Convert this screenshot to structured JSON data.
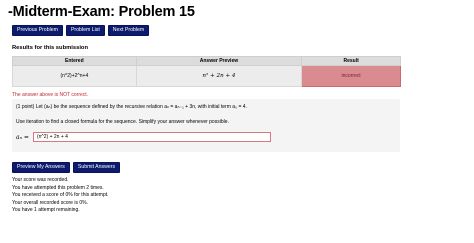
{
  "page": {
    "title": "-Midterm-Exam: Problem 15"
  },
  "nav": {
    "previous_label": "Previous Problem",
    "list_label": "Problem List",
    "next_label": "Next Problem"
  },
  "results": {
    "heading": "Results for this submission",
    "columns": [
      "Entered",
      "Answer Preview",
      "Result"
    ],
    "row": {
      "entered": "(n^2)+2^n+4",
      "preview": "n² + 2n + 4",
      "result": "incorrect"
    }
  },
  "feedback": {
    "warning": "The answer above is NOT correct."
  },
  "problem": {
    "intro": "(1 point) Let (aₙ) be the sequence defined by the recursive relation aₙ = aₙ₋₁ + 3n, with initial term a₀ = 4.",
    "instruction": "Use iteration to find a closed formula for the sequence. Simplify your answer whenever possible.",
    "answer_label": "aₙ =",
    "answer_value": "(n^2) + 2n + 4"
  },
  "actions": {
    "preview_label": "Preview My Answers",
    "submit_label": "Submit Answers"
  },
  "status": {
    "lines": [
      "Your score was recorded.",
      "You have attempted this problem 2 times.",
      "You received a score of 0% for this attempt.",
      "Your overall recorded score is 0%.",
      "You have 1 attempt remaining."
    ]
  },
  "colors": {
    "nav_button": "#0d1b6e",
    "incorrect_bg": "#d98b90",
    "warning_text": "#c22a2a"
  }
}
